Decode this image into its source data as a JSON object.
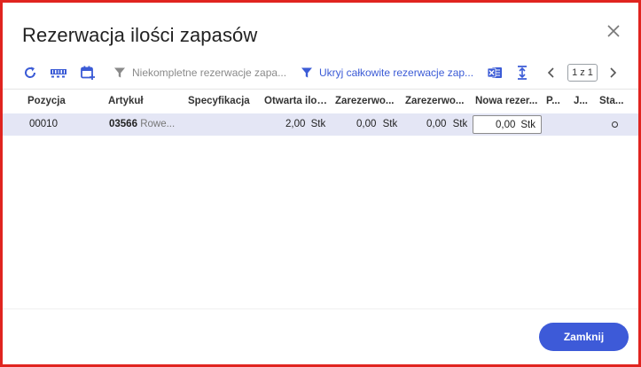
{
  "dialog": {
    "title": "Rezerwacja ilości zapasów"
  },
  "toolbar": {
    "filter_incomplete_label": "Niekompletne rezerwacje zapa...",
    "hide_complete_label": "Ukryj całkowite rezerwacje zap...",
    "pager_label": "1 z 1",
    "accent_color": "#3b5bd6"
  },
  "table": {
    "headers": {
      "position": "Pozycja",
      "article": "Artykuł",
      "specification": "Specyfikacja",
      "open_qty": "Otwarta iloś...",
      "reserved1": "Zarezerwo...",
      "reserved2": "Zarezerwo...",
      "new_reservation": "Nowa rezer...",
      "p": "P...",
      "j": "J...",
      "status": "Sta..."
    },
    "row": {
      "position": "00010",
      "article_code": "03566",
      "article_name": "Rowe...",
      "open_qty": "2,00",
      "open_unit": "Stk",
      "reserved1": "0,00",
      "reserved1_unit": "Stk",
      "reserved2": "0,00",
      "reserved2_unit": "Stk",
      "new_reservation": "0,00",
      "new_reservation_unit": "Stk"
    }
  },
  "footer": {
    "close_label": "Zamknij",
    "button_color": "#3d5ad8"
  },
  "icons": [
    "refresh-icon",
    "barcode-icon",
    "calendar-add-icon",
    "filter-icon",
    "excel-icon",
    "fit-height-icon",
    "chevron-left-icon",
    "chevron-right-icon",
    "close-icon"
  ]
}
